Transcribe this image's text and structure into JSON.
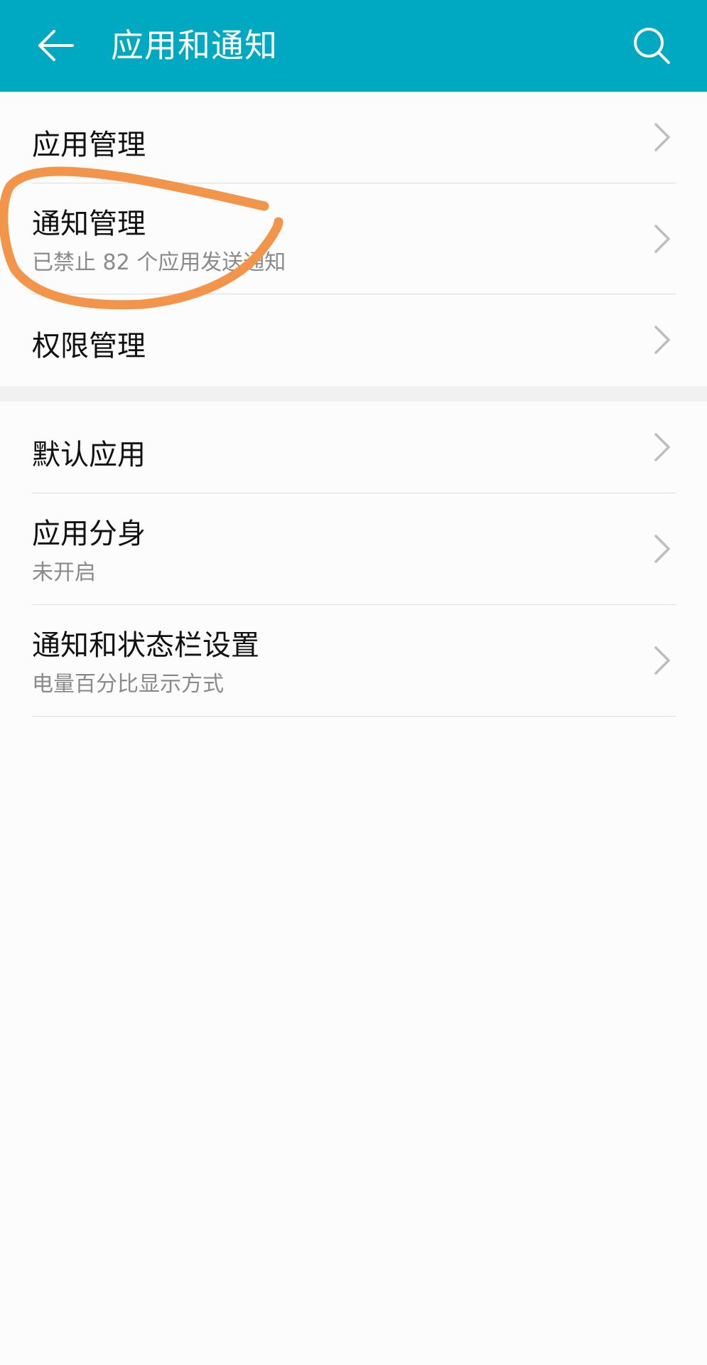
{
  "header": {
    "title": "应用和通知",
    "back_icon": "back-arrow-icon",
    "search_icon": "search-icon",
    "background_color": "#00a9c2"
  },
  "section1": {
    "items": [
      {
        "title": "应用管理",
        "subtitle": ""
      },
      {
        "title": "通知管理",
        "subtitle": "已禁止 82 个应用发送通知"
      },
      {
        "title": "权限管理",
        "subtitle": ""
      }
    ]
  },
  "section2": {
    "items": [
      {
        "title": "默认应用",
        "subtitle": ""
      },
      {
        "title": "应用分身",
        "subtitle": "未开启"
      },
      {
        "title": "通知和状态栏设置",
        "subtitle": "电量百分比显示方式"
      }
    ]
  },
  "annotation": {
    "type": "hand-drawn circle",
    "color": "#f2944a"
  }
}
